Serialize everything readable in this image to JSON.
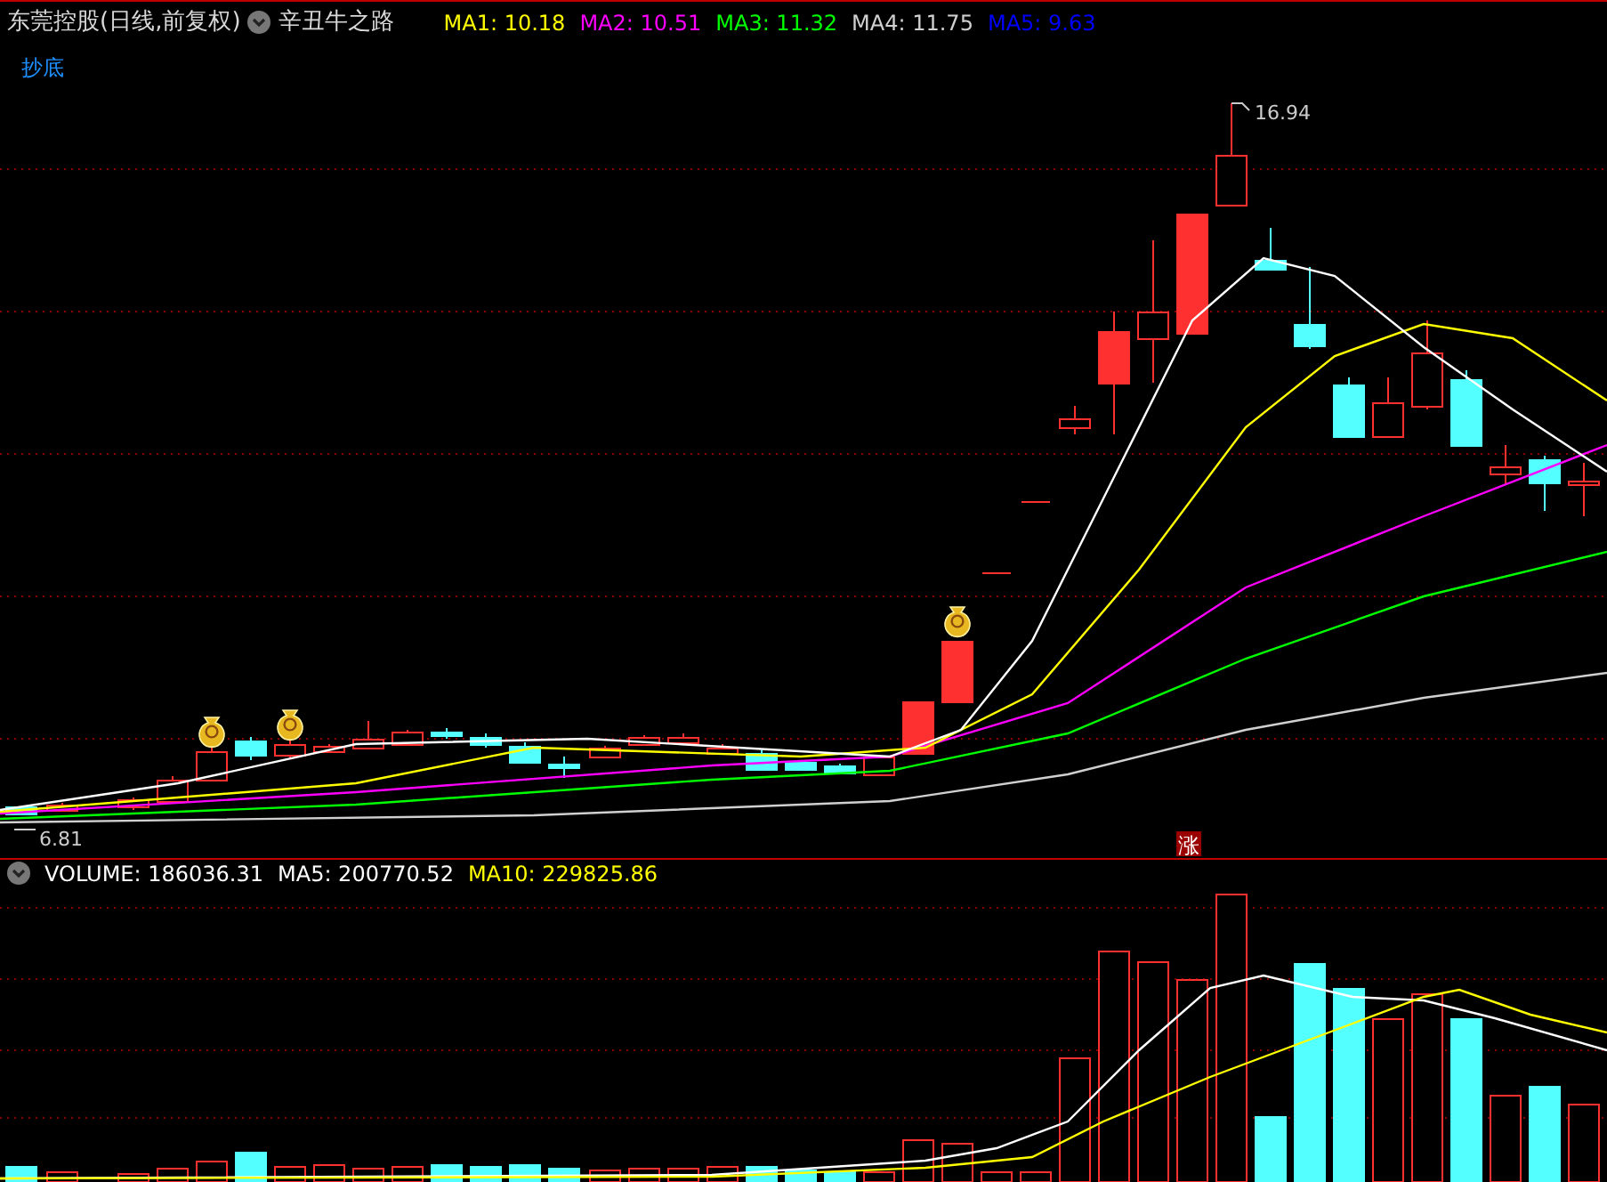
{
  "header": {
    "title": "东莞控股(日线,前复权)",
    "indicator": "辛丑牛之路",
    "ma_values": [
      {
        "label": "MA1: 10.18",
        "color": "#ffff00"
      },
      {
        "label": "MA2: 10.51",
        "color": "#ff00ff"
      },
      {
        "label": "MA3: 11.32",
        "color": "#00ff00"
      },
      {
        "label": "MA4: 11.75",
        "color": "#d0d0d0"
      },
      {
        "label": "MA5: 9.63",
        "color": "#0000ff"
      }
    ]
  },
  "signal_label": "抄底",
  "price_labels": {
    "high": "16.94",
    "low": "6.81"
  },
  "marker": "涨",
  "volume_header": {
    "values": [
      {
        "label": "VOLUME: 186036.31",
        "color": "#ffffff"
      },
      {
        "label": "MA5: 200770.52",
        "color": "#ffffff"
      },
      {
        "label": "MA10: 229825.86",
        "color": "#ffff00"
      }
    ]
  }
}
